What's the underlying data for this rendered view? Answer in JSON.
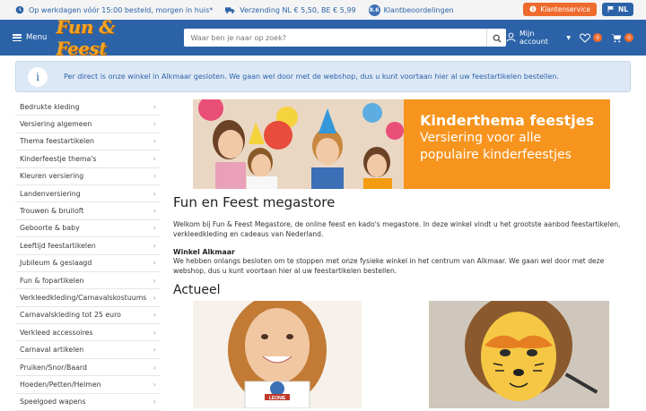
{
  "topbar": {
    "usp1": "Op werkdagen vóór 15:00 besteld, morgen in huis*",
    "usp2": "Verzending NL € 5,50, BE € 5,99",
    "rating": "8.6",
    "usp3": "Klantbeoordelingen",
    "service_label": "Klantenservice",
    "lang_label": "NL"
  },
  "header": {
    "menu_label": "Menu",
    "logo_text": "Fun & Feest",
    "search_placeholder": "Waar ben je naar op zoek?",
    "account_label": "Mijn account",
    "wishlist_count": "0",
    "cart_count": "0"
  },
  "notice": {
    "icon_glyph": "i",
    "text": "Per direct is onze winkel in Alkmaar gesloten. We gaan wel door met de webshop, dus u kunt voortaan hier al uw feestartikelen bestellen."
  },
  "sidebar": {
    "items": [
      "Bedrukte kleding",
      "Versiering algemeen",
      "Thema feestartikelen",
      "Kinderfeestje thema's",
      "Kleuren versiering",
      "Landenversiering",
      "Trouwen & bruiloft",
      "Geboorte & baby",
      "Leeftijd feestartikelen",
      "Jubileum & geslaagd",
      "Fun & fopartikelen",
      "Verkleedkleding/Carnavalskostuums",
      "Carnavalskleding tot 25 euro",
      "Verkleed accessoires",
      "Carnaval artikelen",
      "Pruiken/Snor/Baard",
      "Hoeden/Petten/Helmen",
      "Speelgoed wapens"
    ]
  },
  "banner": {
    "title": "Kinderthema feestjes",
    "line1": "Versiering voor alle",
    "line2": "populaire kinderfeestjes"
  },
  "content": {
    "heading": "Fun en Feest megastore",
    "intro": "Welkom bij Fun & Feest Megastore, de online feest en kado's megastore. In deze winkel vindt u het grootste aanbod feestartikelen, verkleedkleding en cadeaus van Nederland.",
    "sub_heading": "Winkel Alkmaar",
    "sub_text": "We hebben onlangs besloten om te stoppen met onze fysieke winkel in het centrum van Alkmaar. We gaan wel door met deze webshop, dus u kunt voortaan hier al uw feestartikelen bestellen.",
    "section_heading": "Actueel",
    "mug_text": "LEONIE"
  },
  "colors": {
    "brand_blue": "#2c63a8",
    "accent_orange": "#ee6a2d",
    "banner_orange": "#f7941d"
  }
}
